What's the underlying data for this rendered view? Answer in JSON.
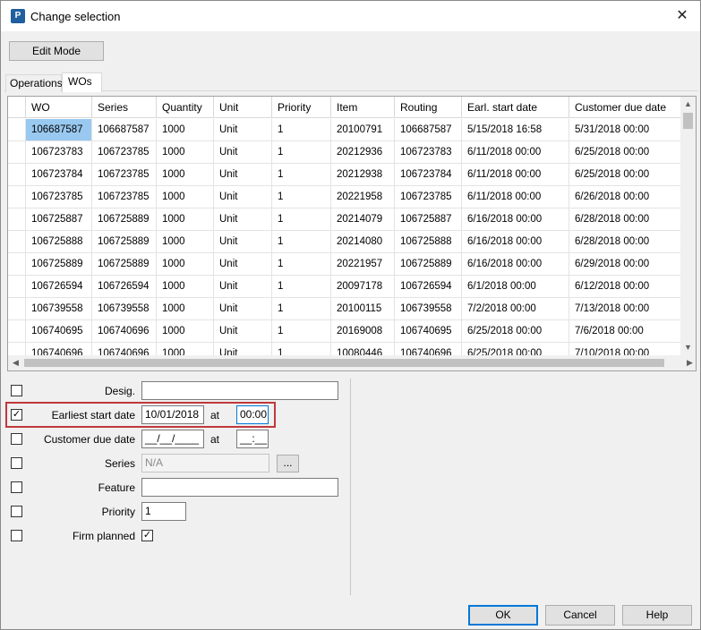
{
  "window": {
    "title": "Change selection",
    "icon_letter": "P",
    "close_glyph": "✕"
  },
  "toolbar": {
    "edit_mode_label": "Edit Mode"
  },
  "tabs": [
    {
      "label": "Operations"
    },
    {
      "label": "WOs"
    }
  ],
  "grid": {
    "columns": [
      "WO",
      "Series",
      "Quantity",
      "Unit",
      "Priority",
      "Item",
      "Routing",
      "Earl. start date",
      "Customer due date"
    ],
    "rows": [
      [
        "106687587",
        "106687587",
        "1000",
        "Unit",
        "1",
        "20100791",
        "106687587",
        "5/15/2018 16:58",
        "5/31/2018 00:00"
      ],
      [
        "106723783",
        "106723785",
        "1000",
        "Unit",
        "1",
        "20212936",
        "106723783",
        "6/11/2018 00:00",
        "6/25/2018 00:00"
      ],
      [
        "106723784",
        "106723785",
        "1000",
        "Unit",
        "1",
        "20212938",
        "106723784",
        "6/11/2018 00:00",
        "6/25/2018 00:00"
      ],
      [
        "106723785",
        "106723785",
        "1000",
        "Unit",
        "1",
        "20221958",
        "106723785",
        "6/11/2018 00:00",
        "6/26/2018 00:00"
      ],
      [
        "106725887",
        "106725889",
        "1000",
        "Unit",
        "1",
        "20214079",
        "106725887",
        "6/16/2018 00:00",
        "6/28/2018 00:00"
      ],
      [
        "106725888",
        "106725889",
        "1000",
        "Unit",
        "1",
        "20214080",
        "106725888",
        "6/16/2018 00:00",
        "6/28/2018 00:00"
      ],
      [
        "106725889",
        "106725889",
        "1000",
        "Unit",
        "1",
        "20221957",
        "106725889",
        "6/16/2018 00:00",
        "6/29/2018 00:00"
      ],
      [
        "106726594",
        "106726594",
        "1000",
        "Unit",
        "1",
        "20097178",
        "106726594",
        "6/1/2018 00:00",
        "6/12/2018 00:00"
      ],
      [
        "106739558",
        "106739558",
        "1000",
        "Unit",
        "1",
        "20100115",
        "106739558",
        "7/2/2018 00:00",
        "7/13/2018 00:00"
      ],
      [
        "106740695",
        "106740696",
        "1000",
        "Unit",
        "1",
        "20169008",
        "106740695",
        "6/25/2018 00:00",
        "7/6/2018 00:00"
      ],
      [
        "106740696",
        "106740696",
        "1000",
        "Unit",
        "1",
        "10080446",
        "106740696",
        "6/25/2018 00:00",
        "7/10/2018 00:00"
      ]
    ],
    "selected_row": 0
  },
  "form": {
    "desig": {
      "label": "Desig.",
      "value": "",
      "checked": false
    },
    "earliest_start": {
      "label": "Earliest start date",
      "date": "10/01/2018",
      "at": "at",
      "time": "00:00",
      "checked": true
    },
    "customer_due": {
      "label": "Customer due date",
      "date": "__/__/____",
      "at": "at",
      "time": "__:__",
      "checked": false
    },
    "series": {
      "label": "Series",
      "value": "N/A",
      "browse": "...",
      "checked": false
    },
    "feature": {
      "label": "Feature",
      "value": "",
      "checked": false
    },
    "priority": {
      "label": "Priority",
      "value": "1",
      "checked": false
    },
    "firm_planned": {
      "label": "Firm planned",
      "checked": false,
      "value_checked": true
    }
  },
  "buttons": {
    "ok": "OK",
    "cancel": "Cancel",
    "help": "Help"
  },
  "colors": {
    "selection": "#99c9f0",
    "highlight": "#c0393b",
    "focus": "#0078d7"
  }
}
